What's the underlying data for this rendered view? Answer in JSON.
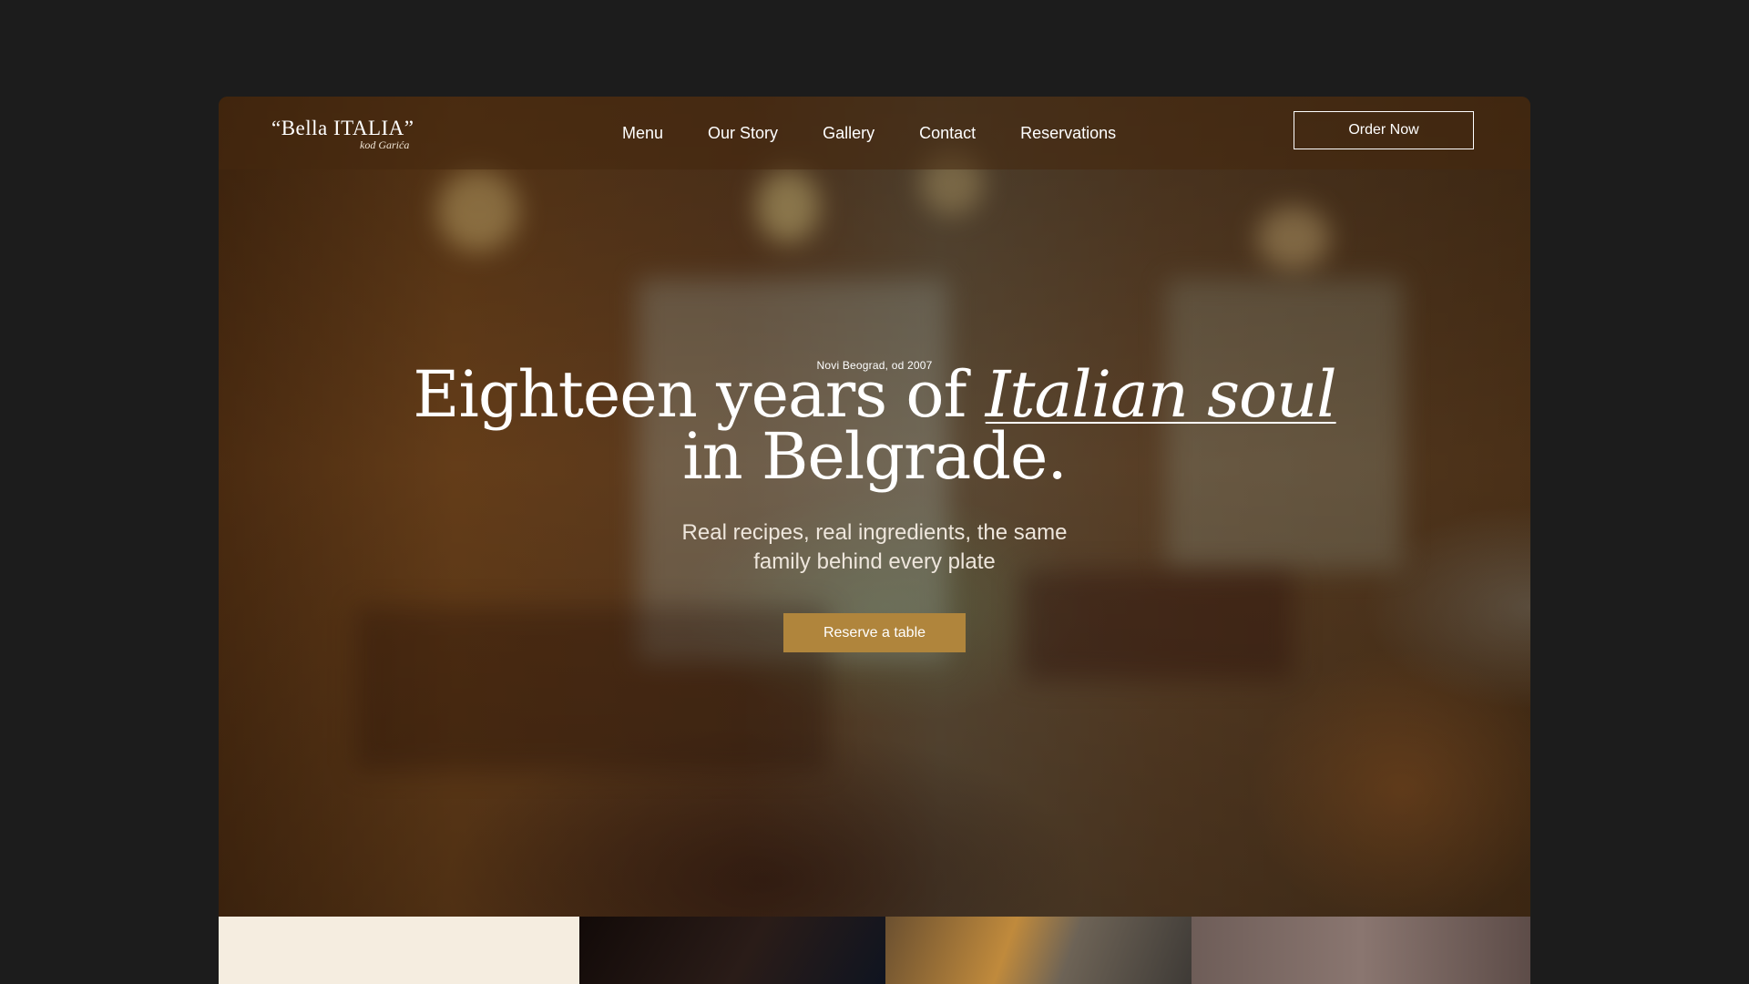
{
  "brand": {
    "name": "“Bella ITALIA”",
    "subtitle": "kod Garića"
  },
  "nav": {
    "items": [
      "Menu",
      "Our Story",
      "Gallery",
      "Contact",
      "Reservations"
    ],
    "cta_label": "Order Now"
  },
  "hero": {
    "eyebrow": "Novi Beograd, od 2007",
    "headline_part1": "Eighteen years of ",
    "headline_emphasis": "Italian soul",
    "headline_part2": "in Belgrade.",
    "subtext": "Real recipes, real ingredients, the same family behind every plate",
    "button_label": "Reserve a table"
  },
  "colors": {
    "page_background": "#1c1c1c",
    "accent_gold": "#b0853c",
    "cream_panel": "#f5ede0"
  },
  "icons": {
    "brand_logo": "bella-italia-wordmark"
  }
}
